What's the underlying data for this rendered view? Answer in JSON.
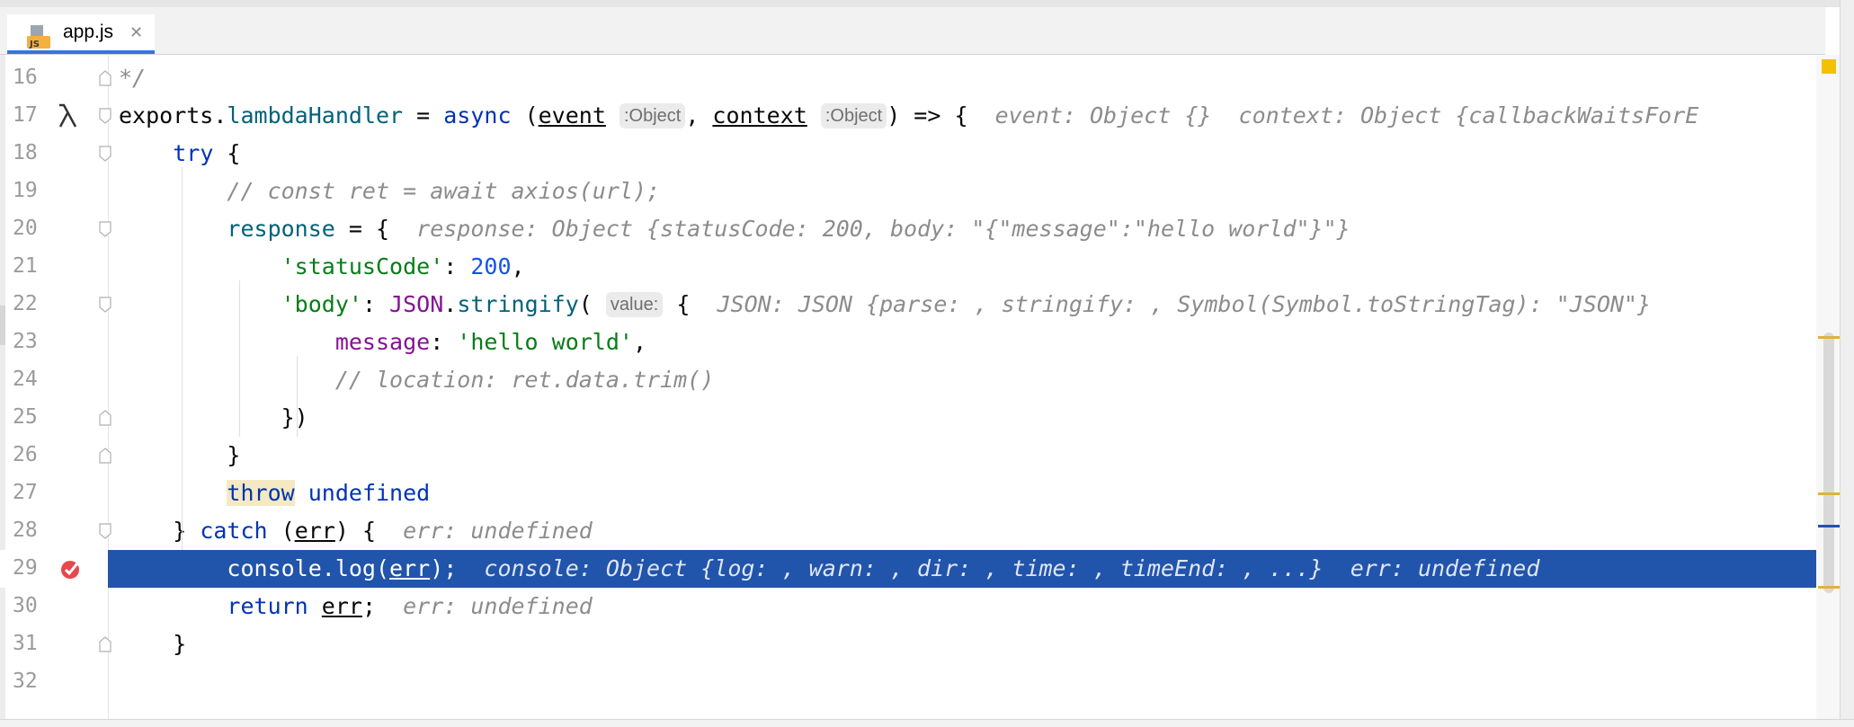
{
  "tab": {
    "label": "app.js",
    "icon_text": "JS",
    "close": "✕"
  },
  "lines": [
    {
      "n": "16",
      "code": "<span class=\"cmt\">*/</span>"
    },
    {
      "n": "17",
      "code": "exports.<span class=\"fn\">lambdaHandler</span> = <span class=\"kw\">async</span> (<span class=\"ul\">event</span> <span class=\"pill\">:Object</span>, <span class=\"ul\">context</span> <span class=\"pill\">:Object</span>) =&gt; {  <span class=\"hint\">event: Object {}  context: Object {callbackWaitsForE</span>"
    },
    {
      "n": "18",
      "code": "    <span class=\"kw\">try</span> {"
    },
    {
      "n": "19",
      "code": "        <span class=\"cmt\">// const ret = await axios(url);</span>"
    },
    {
      "n": "20",
      "code": "        <span class=\"fn\">response</span> = {  <span class=\"hint\">response: Object {statusCode: 200, body: \"{\"message\":\"hello world\"}\"}</span>"
    },
    {
      "n": "21",
      "code": "            <span class=\"str\">'statusCode'</span>: <span class=\"num\">200</span>,"
    },
    {
      "n": "22",
      "code": "            <span class=\"str\">'body'</span>: <span class=\"prop\">JSON</span>.<span class=\"fn\">stringify</span>( <span class=\"pill\">value:</span> {  <span class=\"hint\">JSON: JSON {parse: , stringify: , Symbol(Symbol.toStringTag): \"JSON\"}</span>"
    },
    {
      "n": "23",
      "code": "                <span class=\"prop\">message</span>: <span class=\"str\">'hello world'</span>,"
    },
    {
      "n": "24",
      "code": "                <span class=\"cmt\">// location: ret.data.trim()</span>"
    },
    {
      "n": "25",
      "code": "            })"
    },
    {
      "n": "26",
      "code": "        }"
    },
    {
      "n": "27",
      "code": "        <span class=\"kw hl-throw\">throw</span> <span class=\"kw\">undefined</span>"
    },
    {
      "n": "28",
      "code": "    } <span class=\"kw\">catch</span> (<span class=\"ul\">err</span>) {  <span class=\"hint\">err: undefined</span>"
    },
    {
      "n": "29",
      "code": "        console.log(<span class=\"ul\">err</span>);  <span class=\"hint\">console: Object {log: , warn: , dir: , time: , timeEnd: , ...}  err: undefined</span>"
    },
    {
      "n": "30",
      "code": "        <span class=\"kw\">return</span> <span class=\"ul\">err</span>;  <span class=\"hint\">err: undefined</span>"
    },
    {
      "n": "31",
      "code": "    }"
    },
    {
      "n": "32",
      "code": ""
    }
  ],
  "execution_line": "29",
  "lambda_line": "17",
  "breakpoint_line": "29",
  "colors": {
    "exec_bg": "#2154ab",
    "keyword": "#0033b3",
    "string": "#067d17",
    "number": "#1750eb",
    "comment": "#8c8c8c"
  }
}
